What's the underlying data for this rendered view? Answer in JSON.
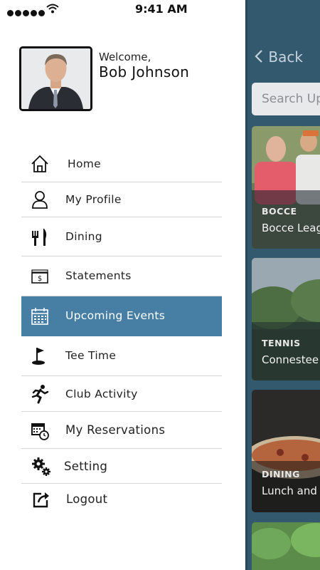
{
  "status_bar": {
    "time": "9:41 AM"
  },
  "profile": {
    "welcome": "Welcome,",
    "name": "Bob Johnson"
  },
  "menu": {
    "items": [
      {
        "label": "Home",
        "icon": "home-icon"
      },
      {
        "label": "My Profile",
        "icon": "user-icon"
      },
      {
        "label": "Dining",
        "icon": "dining-icon"
      },
      {
        "label": "Statements",
        "icon": "statement-icon"
      },
      {
        "label": "Upcoming Events",
        "icon": "calendar-icon",
        "active": true
      },
      {
        "label": "Tee Time",
        "icon": "golf-flag-icon"
      },
      {
        "label": "Club Activity",
        "icon": "running-icon"
      },
      {
        "label": "My Reservations",
        "icon": "reservation-calendar-icon"
      },
      {
        "label": "Setting",
        "icon": "gears-icon"
      },
      {
        "label": "Logout",
        "icon": "logout-icon"
      }
    ]
  },
  "background": {
    "back_label": "Back",
    "search_placeholder": "Search Up",
    "cards": [
      {
        "category": "BOCCE",
        "title": "Bocce Leag"
      },
      {
        "category": "TENNIS",
        "title": "Connestee"
      },
      {
        "category": "DINING",
        "title": "Lunch and"
      }
    ]
  },
  "colors": {
    "accent": "#467fa3",
    "background_panel": "#33596f"
  }
}
